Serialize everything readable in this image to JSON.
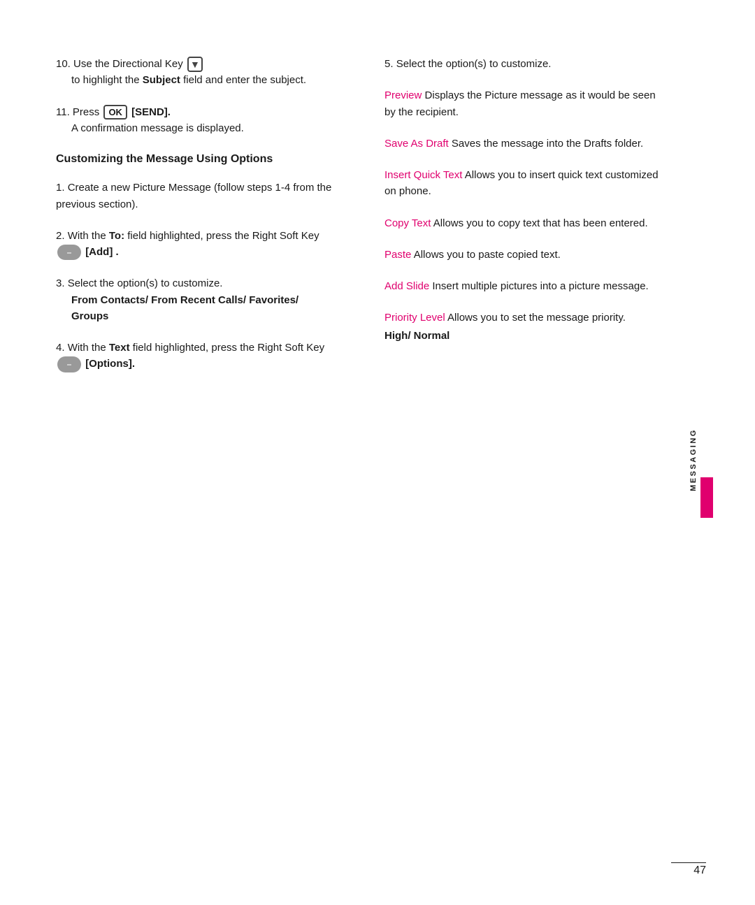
{
  "page": {
    "number": "47",
    "sidebar_label": "MESSAGING"
  },
  "left_column": {
    "step10": {
      "number": "10.",
      "text": "Use the Directional Key",
      "indent": "to highlight the",
      "bold_word": "Subject",
      "rest": "field and enter the subject."
    },
    "step11": {
      "number": "11.",
      "text": "Press",
      "ok_label": "OK",
      "send": "[SEND].",
      "indent": "A confirmation message is displayed."
    },
    "section_heading": "Customizing the Message Using Options",
    "step1": {
      "number": "1.",
      "text": "Create a new Picture Message (follow steps 1-4 from the previous section)."
    },
    "step2": {
      "number": "2.",
      "text": "With the",
      "bold_word": "To:",
      "rest": "field highlighted, press the Right Soft Key",
      "bracket": "[Add] ."
    },
    "step3": {
      "number": "3.",
      "text": "Select the option(s) to customize.",
      "bold_indent": "From Contacts/ From Recent Calls/ Favorites/ Groups"
    },
    "step4": {
      "number": "4.",
      "text": "With the",
      "bold_word": "Text",
      "rest": "field highlighted, press the Right Soft Key",
      "bracket": "[Options]."
    }
  },
  "right_column": {
    "step5_intro": {
      "number": "5.",
      "text": "Select the option(s) to customize."
    },
    "options": [
      {
        "id": "preview",
        "label": "Preview",
        "desc": "Displays the Picture message as it would be seen by the recipient."
      },
      {
        "id": "save-as-draft",
        "label": "Save As Draft",
        "desc": "Saves the message into the Drafts folder."
      },
      {
        "id": "insert-quick-text",
        "label": "Insert Quick Text",
        "desc": "Allows you to insert quick text customized on phone."
      },
      {
        "id": "copy-text",
        "label": "Copy Text",
        "desc": "Allows you to copy text that has been entered."
      },
      {
        "id": "paste",
        "label": "Paste",
        "desc": "Allows you to paste copied text."
      },
      {
        "id": "add-slide",
        "label": "Add Slide",
        "desc": "Insert multiple pictures into a picture message."
      },
      {
        "id": "priority-level",
        "label": "Priority Level",
        "desc": "Allows you to set the message priority.",
        "bold_suffix": "High/ Normal"
      }
    ]
  }
}
